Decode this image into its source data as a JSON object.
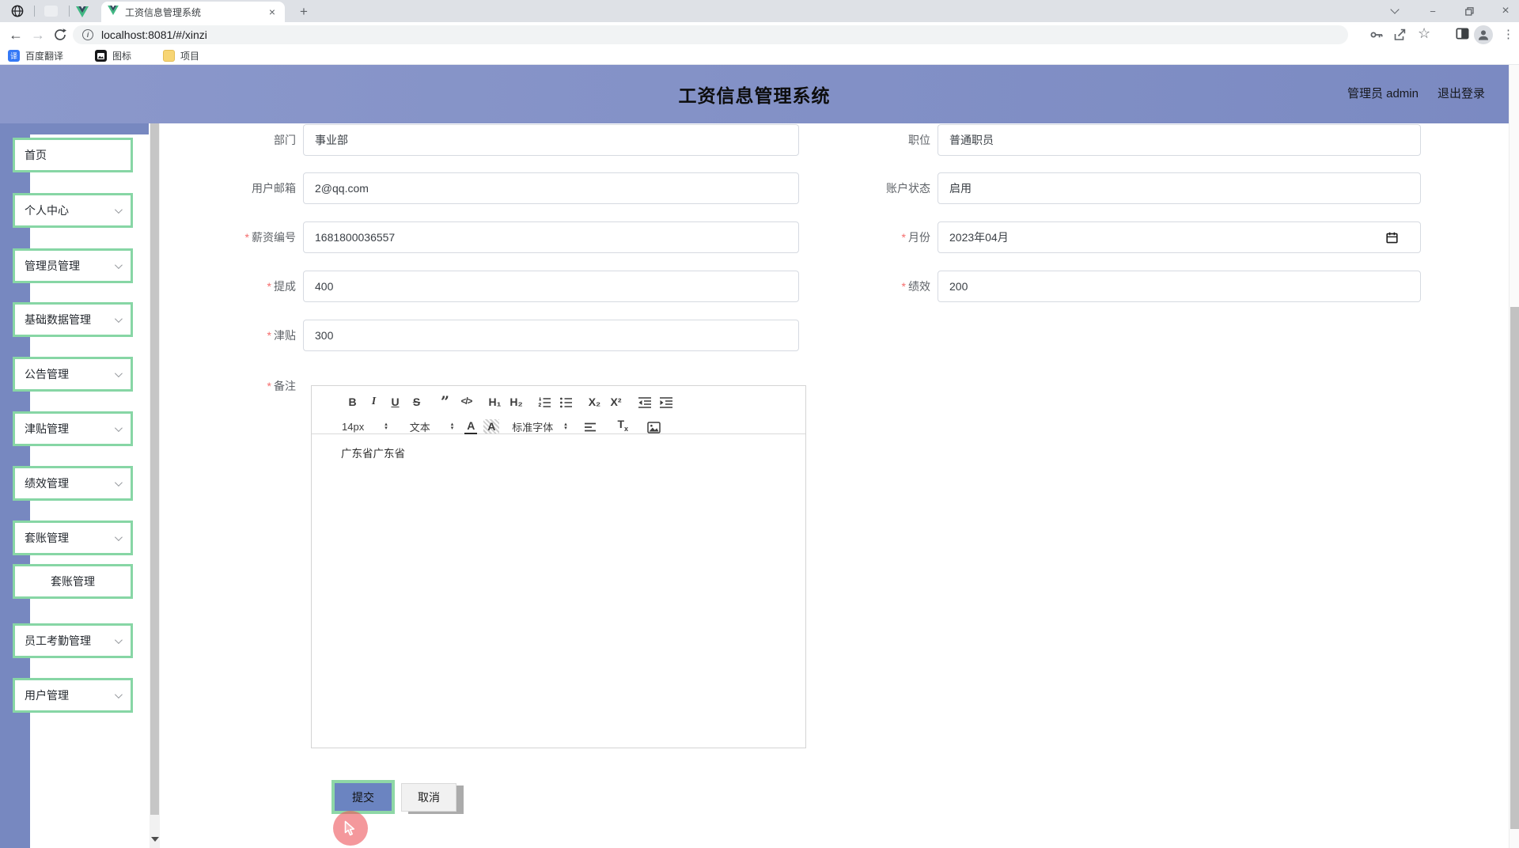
{
  "browser": {
    "tab_title": "工资信息管理系统",
    "address": "localhost:8081/#/xinzi",
    "bookmarks": [
      {
        "label": "百度翻译",
        "badge": "译"
      },
      {
        "label": "图标"
      },
      {
        "label": "项目"
      }
    ],
    "icons": {
      "close": "×",
      "plus": "+",
      "minimize": "−",
      "more": "⋮",
      "star": "☆",
      "back": "←",
      "forward": "→",
      "up": "▴",
      "down": "▾",
      "info": "i"
    }
  },
  "header": {
    "title": "工资信息管理系统",
    "user": "管理员 admin",
    "logout": "退出登录"
  },
  "sidebar": {
    "items": [
      {
        "label": "首页"
      },
      {
        "label": "个人中心"
      },
      {
        "label": "管理员管理"
      },
      {
        "label": "基础数据管理"
      },
      {
        "label": "公告管理"
      },
      {
        "label": "津贴管理"
      },
      {
        "label": "绩效管理"
      },
      {
        "label": "套账管理"
      },
      {
        "label": "套账管理"
      },
      {
        "label": "员工考勤管理"
      },
      {
        "label": "用户管理"
      }
    ]
  },
  "form": {
    "required_mark": "*",
    "fields": {
      "department": {
        "label": "部门",
        "value": "事业部"
      },
      "position": {
        "label": "职位",
        "value": "普通职员"
      },
      "email": {
        "label": "用户邮箱",
        "value": "2@qq.com"
      },
      "status": {
        "label": "账户状态",
        "value": "启用"
      },
      "salary_no": {
        "label": "薪资编号",
        "value": "1681800036557"
      },
      "month": {
        "label": "月份",
        "value": "2023年04月"
      },
      "commission": {
        "label": "提成",
        "value": "400"
      },
      "performance": {
        "label": "绩效",
        "value": "200"
      },
      "allowance": {
        "label": "津贴",
        "value": "300"
      },
      "remark": {
        "label": "备注",
        "value": "广东省广东省"
      }
    }
  },
  "editor": {
    "bold": "B",
    "italic": "I",
    "underline": "U",
    "strike": "S",
    "quote": "”",
    "code": "</>",
    "h1": "H₁",
    "h2": "H₂",
    "subscript": "X₂",
    "superscript": "X²",
    "size": "14px",
    "format": "文本",
    "font": "标准字体",
    "color": "A",
    "background": "A",
    "clear_t": "T",
    "clear_x": "x"
  },
  "actions": {
    "submit": "提交",
    "cancel": "取消"
  },
  "colors": {
    "header_purple": "#8190c4",
    "sidebar_purple": "#7788c0",
    "mint_green": "#87d6a5",
    "submit_blue": "#6b84c1",
    "required_red": "#f56c6c",
    "click_red": "#ec545a"
  }
}
